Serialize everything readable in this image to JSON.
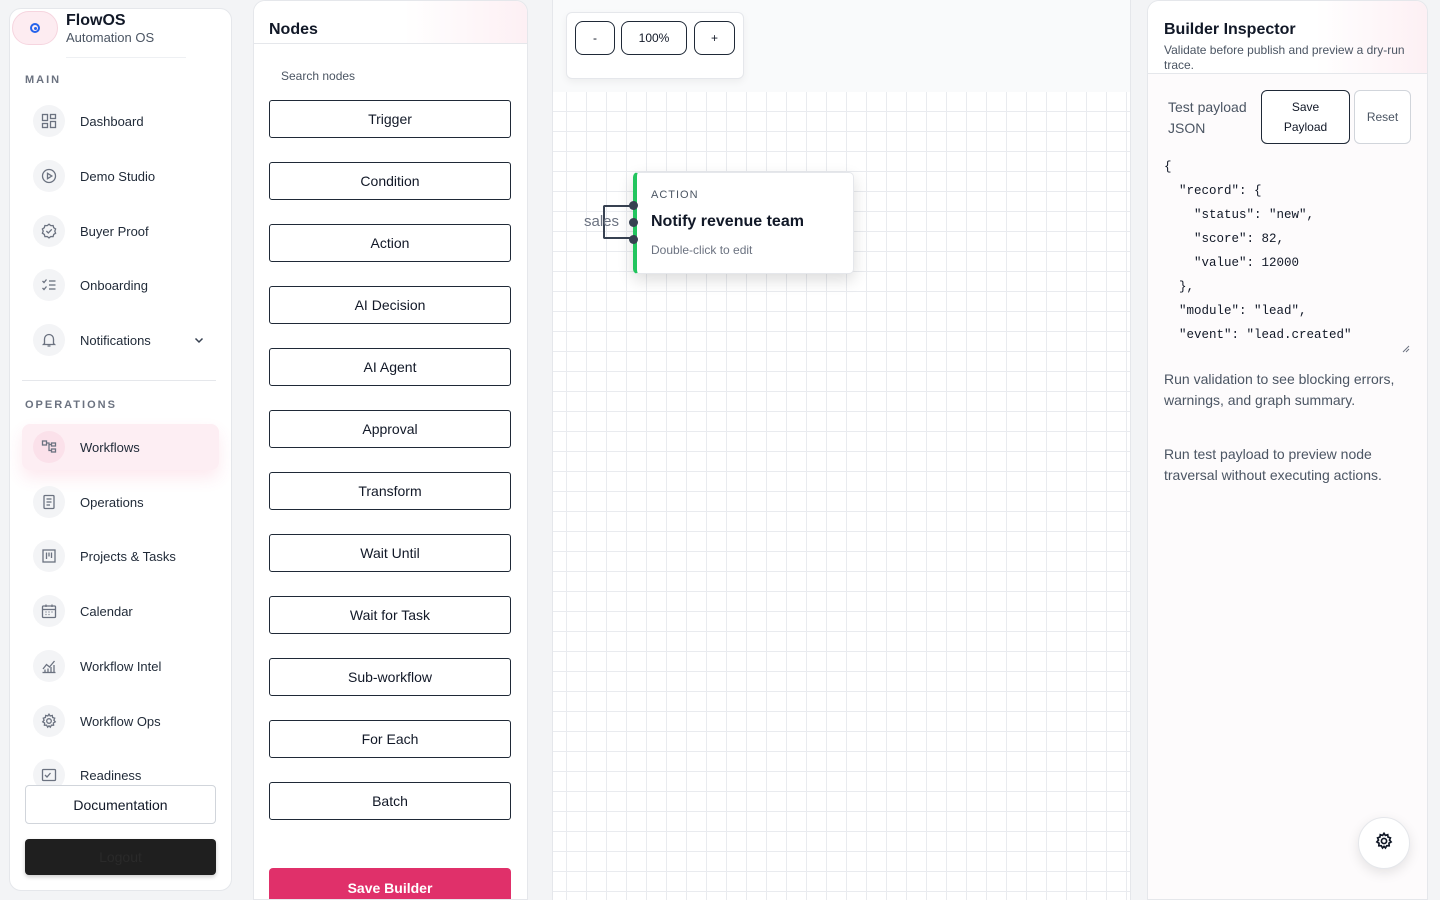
{
  "brand": {
    "name": "FlowOS",
    "subtitle": "Automation OS"
  },
  "sidebar": {
    "sections": {
      "main": "MAIN",
      "operations": "OPERATIONS"
    },
    "main_items": [
      {
        "label": "Dashboard",
        "icon": "grid-icon"
      },
      {
        "label": "Demo Studio",
        "icon": "play-icon"
      },
      {
        "label": "Buyer Proof",
        "icon": "check-badge-icon"
      },
      {
        "label": "Onboarding",
        "icon": "checklist-icon"
      },
      {
        "label": "Notifications",
        "icon": "bell-icon"
      }
    ],
    "operations_items": [
      {
        "label": "Workflows",
        "icon": "workflow-icon",
        "active": true
      },
      {
        "label": "Operations",
        "icon": "document-icon"
      },
      {
        "label": "Projects & Tasks",
        "icon": "board-icon"
      },
      {
        "label": "Calendar",
        "icon": "calendar-icon"
      },
      {
        "label": "Workflow Intel",
        "icon": "chart-icon"
      },
      {
        "label": "Workflow Ops",
        "icon": "gear-icon"
      },
      {
        "label": "Readiness",
        "icon": "readiness-icon"
      }
    ],
    "documentation_label": "Documentation",
    "logout_label": "Logout"
  },
  "nodes_panel": {
    "title": "Nodes",
    "search_placeholder": "Search nodes",
    "items": [
      "Trigger",
      "Condition",
      "Action",
      "AI Decision",
      "AI Agent",
      "Approval",
      "Transform",
      "Wait Until",
      "Wait for Task",
      "Sub-workflow",
      "For Each",
      "Batch"
    ],
    "save_label": "Save Builder"
  },
  "canvas": {
    "zoom": {
      "minus": "-",
      "level": "100%",
      "plus": "+"
    },
    "node": {
      "kind": "ACTION",
      "title": "Notify revenue team",
      "hint": "Double-click to edit"
    },
    "edge_label": "sales"
  },
  "inspector": {
    "title": "Builder Inspector",
    "subtitle": "Validate before publish and preview a dry-run trace.",
    "payload_label": "Test payload JSON",
    "save_payload_label": "Save Payload",
    "reset_label": "Reset",
    "payload_json": "{\n  \"record\": {\n    \"status\": \"new\",\n    \"score\": 82,\n    \"value\": 12000\n  },\n  \"module\": \"lead\",\n  \"event\": \"lead.created\"\n}",
    "validation_msg": "Run validation to see blocking errors, warnings, and graph summary.",
    "trace_msg": "Run test payload to preview node traversal without executing actions."
  },
  "colors": {
    "accent": "#e0306a",
    "action_node": "#22c55e",
    "active_nav_bg": "#fdeef3"
  }
}
